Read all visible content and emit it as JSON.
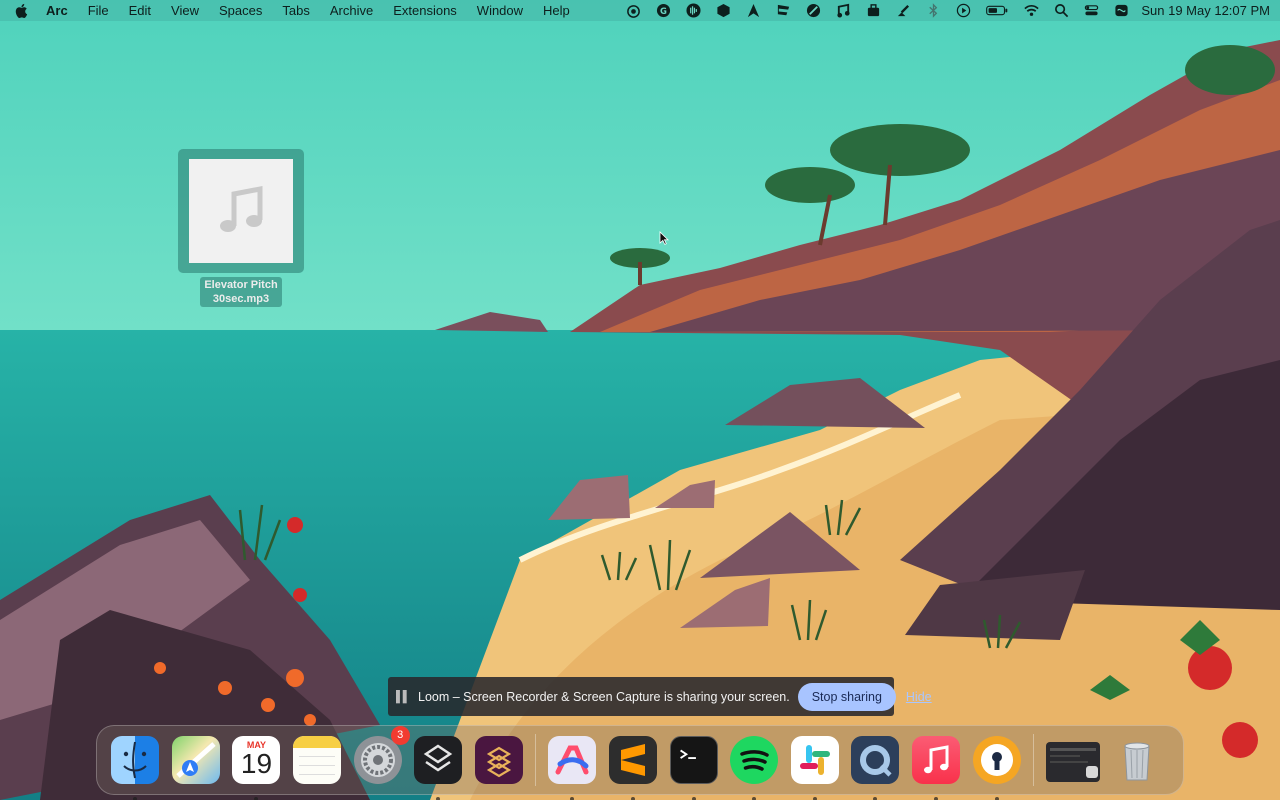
{
  "menubar": {
    "app_name": "Arc",
    "menus": [
      "File",
      "Edit",
      "View",
      "Spaces",
      "Tabs",
      "Archive",
      "Extensions",
      "Window",
      "Help"
    ],
    "status_icons": [
      "airdrop-icon",
      "grammarly-icon",
      "audio-waveform-icon",
      "notion-icon",
      "navigation-icon",
      "flag-icon",
      "sphere-icon",
      "music-note-icon",
      "toolbox-icon",
      "paintbrush-icon",
      "bluetooth-icon",
      "play-icon",
      "battery-icon",
      "wifi-icon",
      "search-icon",
      "control-center-icon",
      "siri-icon"
    ],
    "clock": "Sun 19 May  12:07 PM"
  },
  "desktop": {
    "file": {
      "name_line1": "Elevator Pitch",
      "name_line2": "30sec.mp3",
      "icon": "music-file-icon"
    }
  },
  "share_bar": {
    "message": "Loom – Screen Recorder & Screen Capture is sharing your screen.",
    "stop_label": "Stop sharing",
    "hide_label": "Hide"
  },
  "dock": {
    "apps": [
      {
        "name": "finder",
        "running": true
      },
      {
        "name": "maps",
        "running": false
      },
      {
        "name": "calendar",
        "month": "MAY",
        "day": "19",
        "running": true
      },
      {
        "name": "notes",
        "running": false
      },
      {
        "name": "system-settings",
        "badge": "3",
        "running": false
      },
      {
        "name": "shortcuts-stack",
        "running": true
      },
      {
        "name": "slack-alt",
        "running": false
      },
      {
        "name": "arc",
        "running": true
      },
      {
        "name": "sublime-text",
        "running": true
      },
      {
        "name": "terminal",
        "running": true
      },
      {
        "name": "spotify",
        "running": true
      },
      {
        "name": "slack",
        "running": true
      },
      {
        "name": "quicktime",
        "running": true
      },
      {
        "name": "music",
        "running": true
      },
      {
        "name": "keeper",
        "running": true
      },
      {
        "name": "recent-window",
        "running": false
      },
      {
        "name": "trash",
        "running": false
      }
    ]
  },
  "colors": {
    "sky": "#55d3c0",
    "sea": "#1f9e98",
    "sand": "#f0c47a",
    "cliff": "#6e4a5a",
    "stop_button": "#a8c4ff"
  }
}
